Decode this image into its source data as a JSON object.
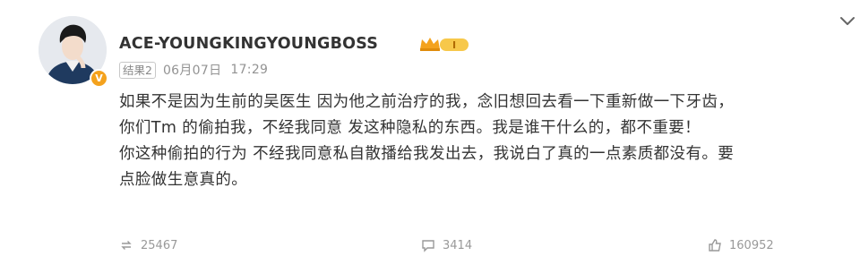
{
  "post": {
    "username": "ACE-YOUNGKINGYOUNGBOSS",
    "tag": "结果2",
    "date": "06月07日",
    "time": "17:29",
    "level_badge": "I",
    "lines": [
      "如果不是因为生前的吴医生 因为他之前治疗的我，念旧想回去看一下重新做一下牙齿，",
      "你们Tm 的偷拍我，不经我同意 发这种隐私的东西。我是谁干什么的，都不重要！",
      "你这种偷拍的行为 不经我同意私自散播给我发出去，我说白了真的一点素质都没有。要",
      "点脸做生意真的。"
    ],
    "actions": {
      "repost_count": "25467",
      "comment_count": "3414",
      "like_count": "160952"
    }
  },
  "colors": {
    "text": "#333333",
    "meta": "#939393",
    "vip": "#f4a21d"
  },
  "icons": [
    "avatar",
    "verified-v-icon",
    "crown-level-icon",
    "chevron-down-icon",
    "repost-icon",
    "comment-icon",
    "like-icon"
  ]
}
